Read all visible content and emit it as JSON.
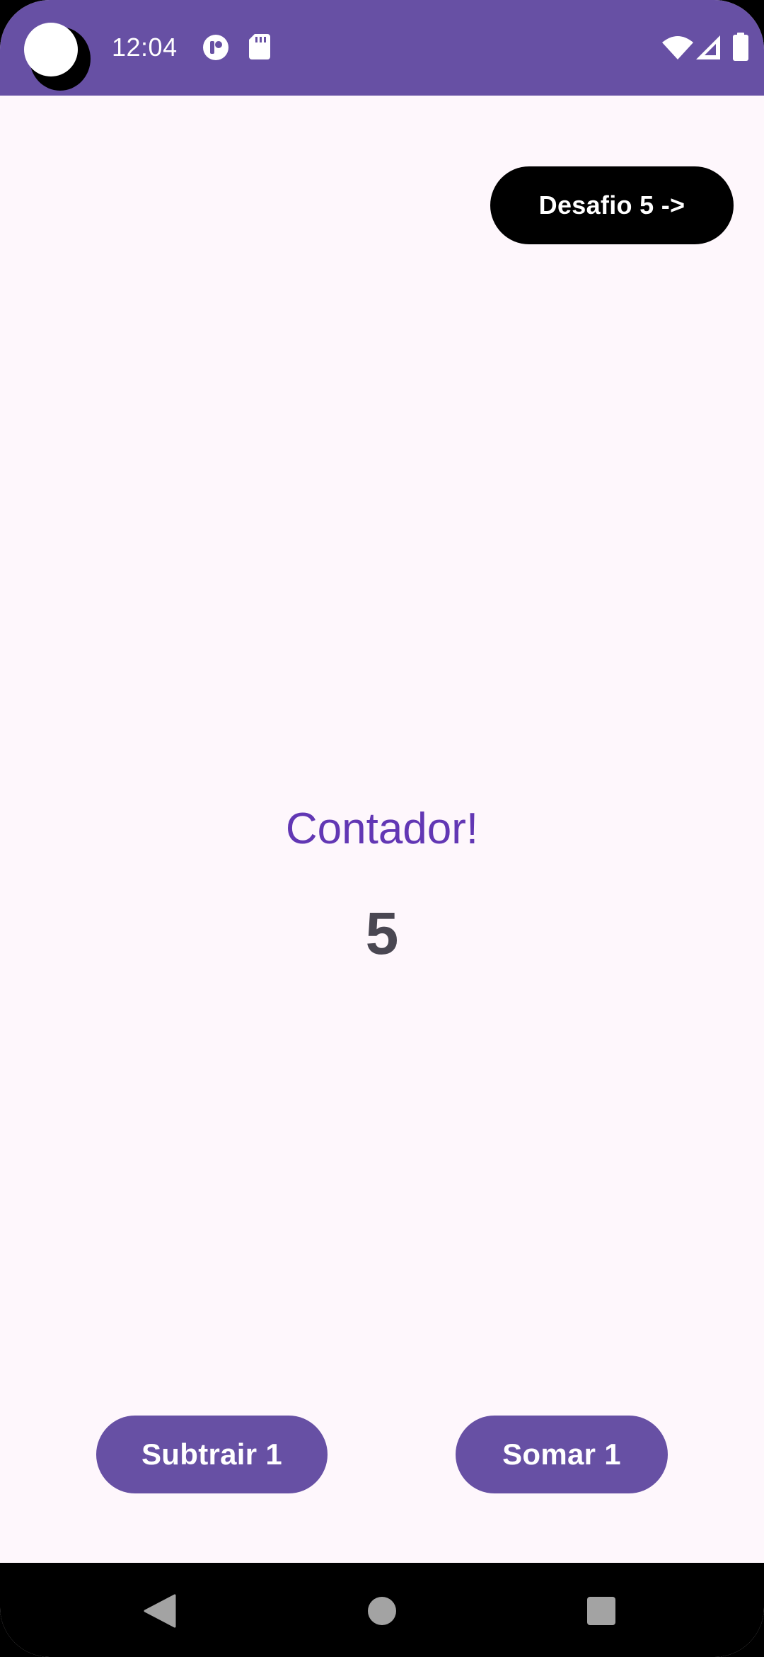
{
  "status_bar": {
    "time": "12:04",
    "icons": [
      "camera-cutout",
      "notification-app-icon",
      "sd-card-icon",
      "wifi-icon",
      "cellular-signal-icon",
      "battery-icon"
    ],
    "background_color": "#6750A4"
  },
  "main": {
    "challenge_button_label": "Desafio 5 ->",
    "counter_title": "Contador!",
    "counter_value": "5",
    "subtract_button_label": "Subtrair 1",
    "add_button_label": "Somar 1"
  },
  "nav_bar": {
    "icons": [
      "back-icon",
      "home-icon",
      "recents-icon"
    ]
  },
  "colors": {
    "accent": "#6750A4",
    "title": "#6237B4",
    "value": "#4A4752",
    "background": "#FEF7FC"
  }
}
